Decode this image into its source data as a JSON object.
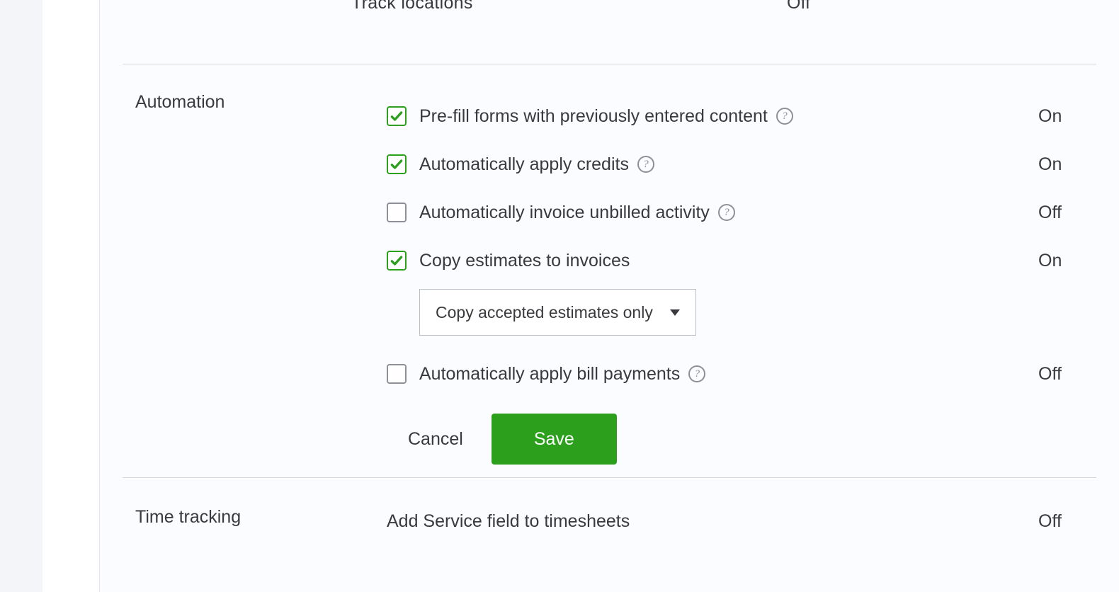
{
  "top_partial": {
    "label": "Track locations",
    "status": "Off"
  },
  "automation": {
    "title": "Automation",
    "items": [
      {
        "label": "Pre-fill forms with previously entered content",
        "checked": true,
        "has_help": true,
        "status": "On"
      },
      {
        "label": "Automatically apply credits",
        "checked": true,
        "has_help": true,
        "status": "On"
      },
      {
        "label": "Automatically invoice unbilled activity",
        "checked": false,
        "has_help": true,
        "status": "Off"
      },
      {
        "label": "Copy estimates to invoices",
        "checked": true,
        "has_help": false,
        "status": "On"
      },
      {
        "label": "Automatically apply bill payments",
        "checked": false,
        "has_help": true,
        "status": "Off"
      }
    ],
    "dropdown": {
      "selected": "Copy accepted estimates only"
    },
    "buttons": {
      "cancel": "Cancel",
      "save": "Save"
    }
  },
  "time_tracking": {
    "title": "Time tracking",
    "item_label": "Add Service field to timesheets",
    "item_status": "Off"
  },
  "help_glyph": "?"
}
